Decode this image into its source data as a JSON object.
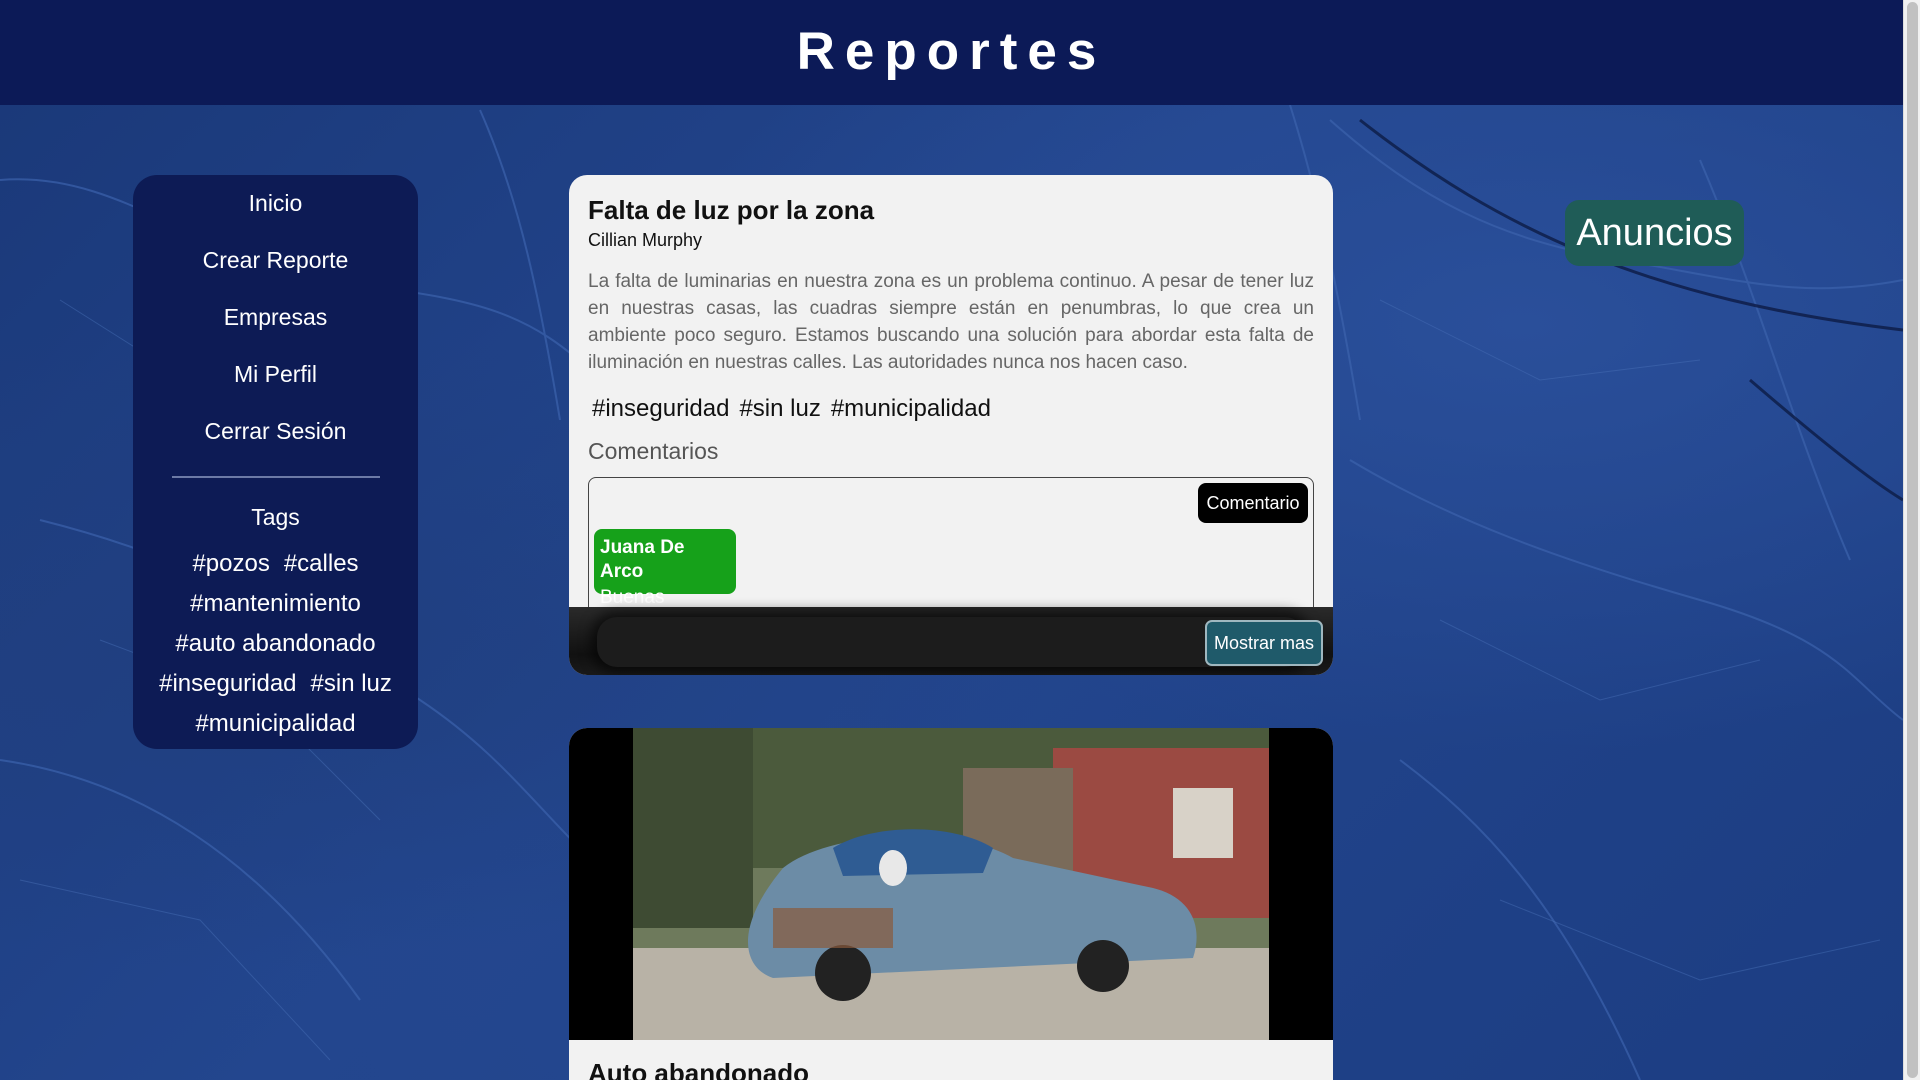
{
  "header": {
    "title": "Reportes"
  },
  "sidebar": {
    "nav": [
      {
        "label": "Inicio"
      },
      {
        "label": "Crear Reporte"
      },
      {
        "label": "Empresas"
      },
      {
        "label": "Mi Perfil"
      },
      {
        "label": "Cerrar Sesión"
      }
    ],
    "tags_title": "Tags",
    "tags": [
      "#pozos",
      "#calles",
      "#mantenimiento",
      "#auto abandonado",
      "#inseguridad",
      "#sin luz",
      "#municipalidad"
    ]
  },
  "post": {
    "title": "Falta de luz por la zona",
    "author": "Cillian Murphy",
    "body": "La falta de luminarias en nuestra zona es un problema continuo. A pesar de tener luz en nuestras casas, las cuadras siempre están en penumbras, lo que crea un ambiente poco seguro. Estamos buscando una solución para abordar esta falta de iluminación en nuestras calles. Las autoridades nunca nos hacen caso.",
    "tags": [
      "#inseguridad",
      "#sin luz",
      "#municipalidad"
    ],
    "comments_title": "Comentarios",
    "comment_button": "Comentario",
    "comments": [
      {
        "author": "Juana De Arco",
        "text": "Buenas"
      }
    ],
    "show_more": "Mostrar mas"
  },
  "post2": {
    "title": "Auto abandonado"
  },
  "ads": {
    "title": "Anuncios"
  },
  "colors": {
    "header_bg": "#0c1a57",
    "sidebar_bg": "#0d1b55",
    "comment_bg": "#16a11a",
    "ads_bg": "#1f5c57",
    "show_more_bg": "#1f5a6a"
  }
}
